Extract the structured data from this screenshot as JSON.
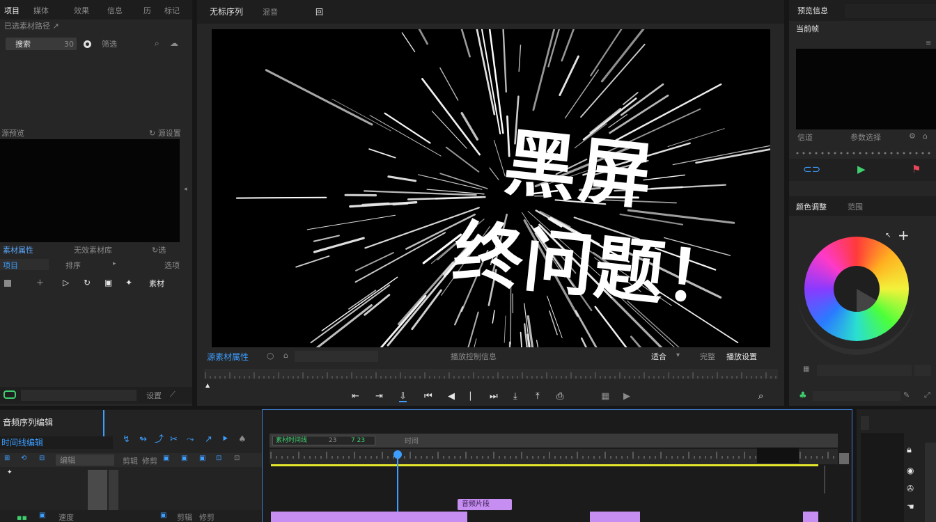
{
  "left_panel": {
    "tabs": [
      "项目",
      "媒体",
      "效果",
      "信息",
      "历",
      "标记"
    ],
    "path_label": "已选素材路径 ↗",
    "search_value": "搜索",
    "search_count": "30",
    "toggle_label": "筛选",
    "section_preview_label": "源预览",
    "section_preview_right": "↻ 源设置",
    "clip_list_header": "素材属性",
    "clip_list_center": "无效素材库",
    "clip_list_right": "↻选",
    "row_left": "项目",
    "row_mid": "排序",
    "row_right": "选项",
    "tool_right_label": "素材",
    "bottom_right": "设置"
  },
  "program": {
    "tab_title": "无标序列",
    "tab_second": "混音",
    "tab_third": "回",
    "overlay_line1": "黑屏",
    "overlay_line2": "终问题！",
    "timecode_label": "源素材属性",
    "center_label": "播放控制信息",
    "right_label_1": "适合",
    "right_label_2": "完整",
    "right_label_3": "播放设置"
  },
  "right_panel": {
    "title": "预览信息",
    "subtitle": "当前帧",
    "label_left": "信道",
    "label_mid": "参数选择",
    "section_title": "颜色调整",
    "section_second": "范围",
    "plus_glyph": "+"
  },
  "timeline": {
    "title": "音频序列编辑",
    "subtitle": "时间线编辑",
    "row_a": "编辑",
    "row_b": "剪辑",
    "row_c": "修剪",
    "row_d": "速度",
    "ruler_left": "素材时间线",
    "ruler_mark_a": "23",
    "ruler_mark_b": "7 23",
    "ruler_center": "时间",
    "clip_label_a": "音频片段"
  },
  "colors": {
    "accent_blue": "#3d9eff",
    "accent_green": "#3ecf6e",
    "accent_red": "#e8475a",
    "clip_purple": "#c68ef0",
    "play_line_yellow": "#e6e62a"
  }
}
